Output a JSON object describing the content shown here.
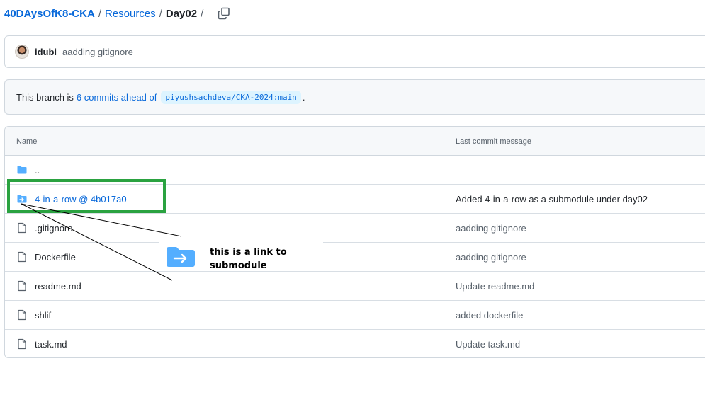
{
  "breadcrumb": {
    "repo": "40DAysOfK8-CKA",
    "folder": "Resources",
    "current": "Day02",
    "separator": "/",
    "copy_icon": "copy-icon"
  },
  "latest_commit": {
    "author": "idubi",
    "message": "aadding gitignore"
  },
  "branch_notice": {
    "prefix": "This branch is",
    "link": "6 commits ahead of",
    "ref": "piyushsachdeva/CKA-2024:main",
    "suffix": "."
  },
  "table": {
    "col_name": "Name",
    "col_message": "Last commit message",
    "rows": [
      {
        "name": "..",
        "message": "",
        "icon": "folder-icon"
      },
      {
        "name": "4-in-a-row @ 4b017a0",
        "message": "Added 4-in-a-row as a submodule under day02",
        "icon": "submodule-icon"
      },
      {
        "name": ".gitignore",
        "message": "aadding gitignore",
        "icon": "file-icon"
      },
      {
        "name": "Dockerfile",
        "message": "aadding gitignore",
        "icon": "file-icon"
      },
      {
        "name": "readme.md",
        "message": "Update readme.md",
        "icon": "file-icon"
      },
      {
        "name": "shlif",
        "message": "added dockerfile",
        "icon": "file-icon"
      },
      {
        "name": "task.md",
        "message": "Update task.md",
        "icon": "file-icon"
      }
    ]
  },
  "annotation": {
    "text_line1": "this is a link to",
    "text_line2": "submodule",
    "box_color": "#2aa240"
  },
  "colors": {
    "link": "#0969da",
    "folder": "#54aeff",
    "border": "#d0d7de"
  }
}
